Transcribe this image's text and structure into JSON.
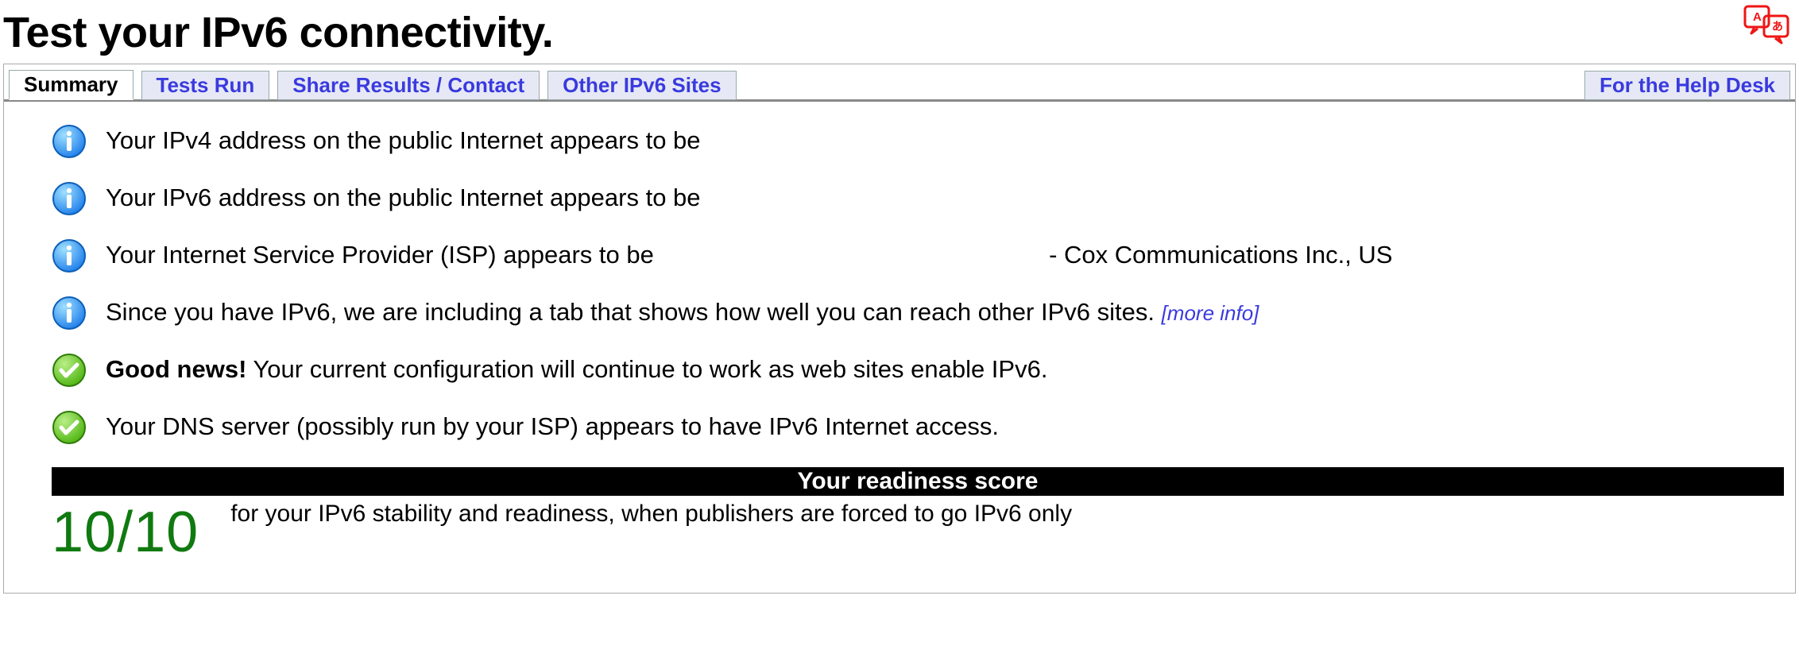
{
  "page": {
    "title": "Test your IPv6 connectivity."
  },
  "tabs": {
    "summary": "Summary",
    "testsRun": "Tests Run",
    "share": "Share Results / Contact",
    "other": "Other IPv6 Sites",
    "helpdesk": "For the Help Desk"
  },
  "results": {
    "ipv4": "Your IPv4 address on the public Internet appears to be",
    "ipv6": "Your IPv6 address on the public Internet appears to be",
    "isp_prefix": "Your Internet Service Provider (ISP) appears to be",
    "isp_value": "- Cox Communications Inc., US",
    "tabinfo": "Since you have IPv6, we are including a tab that shows how well you can reach other IPv6 sites.",
    "more_info": "[more info]",
    "goodnews_bold": "Good news!",
    "goodnews_rest": " Your current configuration will continue to work as web sites enable IPv6.",
    "dns": "Your DNS server (possibly run by your ISP) appears to have IPv6 Internet access."
  },
  "score": {
    "header": "Your readiness score",
    "value": "10/10",
    "desc": "for your IPv6 stability and readiness, when publishers are forced to go IPv6 only"
  }
}
